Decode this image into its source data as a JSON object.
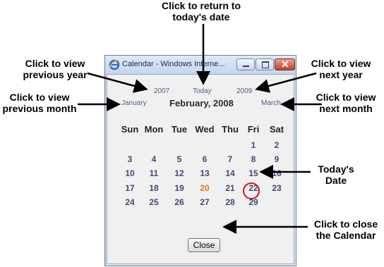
{
  "annotations": {
    "today": [
      "Click to return to",
      "today's date"
    ],
    "prev_year": [
      "Click to view",
      "previous year"
    ],
    "next_year": [
      "Click to view",
      "next year"
    ],
    "prev_month": [
      "Click to view",
      "previous month"
    ],
    "next_month": [
      "Click to view",
      "next month"
    ],
    "todays_date": [
      "Today's",
      "Date"
    ],
    "close": [
      "Click to close",
      "the Calendar"
    ]
  },
  "window": {
    "title": "Calendar - Windows Interne...",
    "icon": "ie-icon",
    "controls": [
      "minimize-icon",
      "maximize-icon",
      "close-icon"
    ]
  },
  "calendar": {
    "prev_year": "2007",
    "today_link": "Today",
    "next_year": "2009",
    "prev_month": "January",
    "month_title": "February, 2008",
    "next_month": "March",
    "weekdays": [
      "Sun",
      "Mon",
      "Tue",
      "Wed",
      "Thu",
      "Fri",
      "Sat"
    ],
    "weeks": [
      [
        "",
        "",
        "",
        "",
        "",
        "1",
        "2"
      ],
      [
        "3",
        "4",
        "5",
        "6",
        "7",
        "8",
        "9"
      ],
      [
        "10",
        "11",
        "12",
        "13",
        "14",
        "15",
        "16"
      ],
      [
        "17",
        "18",
        "19",
        "20",
        "21",
        "22",
        "23"
      ],
      [
        "24",
        "25",
        "26",
        "27",
        "28",
        "29",
        ""
      ]
    ],
    "today": "20",
    "close_label": "Close"
  },
  "colors": {
    "link": "#4c5f8c",
    "day": "#3c4a7a",
    "today_text": "#e07a10",
    "today_ring": "#e01010"
  }
}
